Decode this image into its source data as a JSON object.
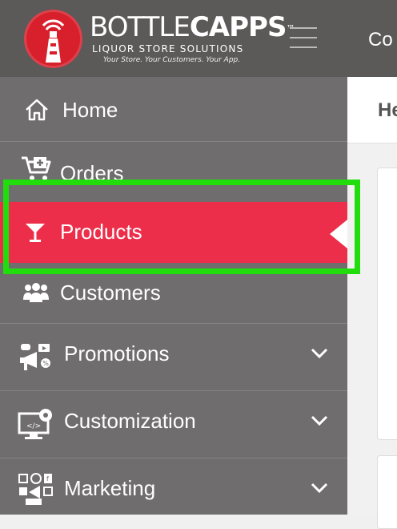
{
  "header": {
    "brand_light": "BOTTLE",
    "brand_bold": "CAPPS",
    "brand_tm": "™",
    "tagline": "LIQUOR STORE SOLUTIONS",
    "slogan": "Your Store. Your Customers. Your App.",
    "title": "Co"
  },
  "sidebar": {
    "items": [
      {
        "label": "Home",
        "icon": "home-icon",
        "expandable": false
      },
      {
        "label": "Orders",
        "icon": "cart-plus-icon",
        "expandable": false
      },
      {
        "label": "Products",
        "icon": "cocktail-glass-icon",
        "expandable": false,
        "active": true
      },
      {
        "label": "Customers",
        "icon": "users-icon",
        "expandable": false
      },
      {
        "label": "Promotions",
        "icon": "megaphone-icon",
        "expandable": true
      },
      {
        "label": "Customization",
        "icon": "monitor-gear-icon",
        "expandable": true
      },
      {
        "label": "Marketing",
        "icon": "marketing-icon",
        "expandable": true
      }
    ]
  },
  "main": {
    "page_title": "He"
  },
  "colors": {
    "header_bg": "#5c5959",
    "sidebar_bg": "#6f6d6d",
    "active_bg": "#ec2e4a",
    "highlight": "#22dd0c",
    "logo_red": "#d8202c"
  }
}
